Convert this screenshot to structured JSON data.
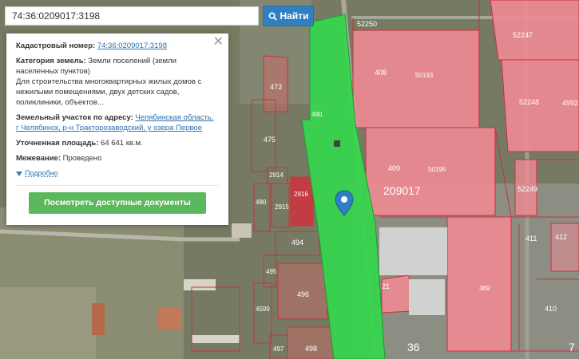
{
  "search": {
    "value": "74:36:0209017:3198",
    "button_label": "Найти"
  },
  "info": {
    "cadastral_label": "Кадастровый номер:",
    "cadastral_value": "74:36:0209017:3198",
    "category_label": "Категория земель:",
    "category_value": "Земли поселений (земли населенных пунктов)",
    "purpose": "Для строительства многоквартирных жилых домов с нежилыми помещениями, двух детских садов, поликлиники, объектов...",
    "address_label": "Земельный участок по адресу:",
    "address_line1": "Челябинская область,",
    "address_line2": "г Челябинск, р-н Тракторозаводский, у озера Первое",
    "area_label": "Уточненная площадь:",
    "area_value": "64 641 кв.м.",
    "survey_label": "Межевание:",
    "survey_value": "Проведено",
    "more_label": "Подробно",
    "docs_button": "Посмотреть доступные документы"
  },
  "map": {
    "labels": {
      "p52250": "52250",
      "p52247": "52247",
      "p408": "408",
      "p50193": "50193",
      "p52248": "52248",
      "p4992": "4992",
      "p409": "409",
      "p50196": "50196",
      "p209017": "209017",
      "p52249": "52249",
      "p473": "473",
      "p475": "475",
      "p490": "490",
      "p2914": "2914",
      "p2915": "2915",
      "p2916": "2916",
      "p480": "480",
      "p494": "494",
      "p495": "495",
      "p496": "496",
      "p4599": "4599",
      "p497": "497",
      "p498": "498",
      "p21": "21",
      "p389": "389",
      "p411": "411",
      "p412": "412",
      "p410": "410",
      "p36": "36",
      "p7": "7"
    },
    "colors": {
      "selected_parcel": "#35d64d",
      "parcel_fill": "#f08a93",
      "parcel_border": "#c8323a",
      "marker": "#2f7fc1"
    }
  }
}
